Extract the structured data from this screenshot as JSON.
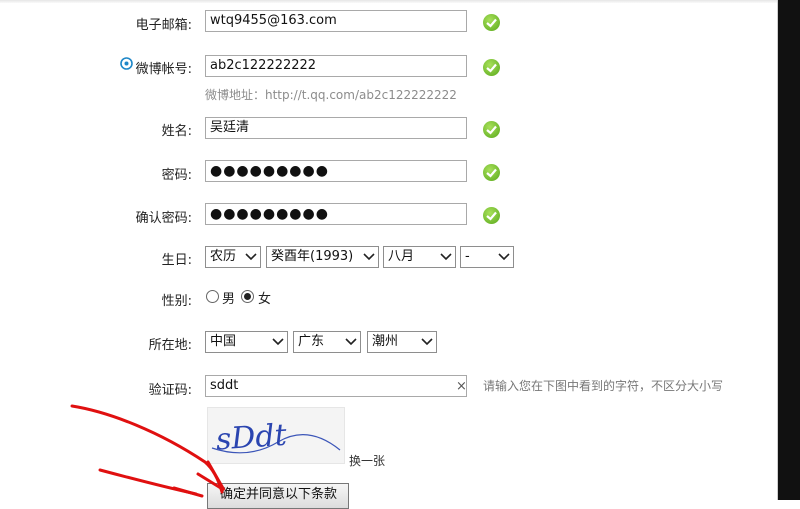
{
  "form": {
    "email": {
      "label": "电子邮箱:",
      "value": "wtq9455@163.com"
    },
    "weibo": {
      "label": "微博帐号:",
      "value": "ab2c122222222",
      "hint": "微博地址：http://t.qq.com/ab2c122222222"
    },
    "name": {
      "label": "姓名:",
      "value": "吴廷清"
    },
    "password": {
      "label": "密码:",
      "value": "●●●●●●●●●"
    },
    "confirm": {
      "label": "确认密码:",
      "value": "●●●●●●●●●"
    },
    "birthday": {
      "label": "生日:",
      "calendar": "农历",
      "year": "癸酉年(1993)",
      "month": "八月",
      "day": "-"
    },
    "gender": {
      "label": "性别:",
      "male": "男",
      "female": "女",
      "selected": "女"
    },
    "location": {
      "label": "所在地:",
      "country": "中国",
      "province": "广东",
      "city": "潮州"
    },
    "captcha": {
      "label": "验证码:",
      "value": "sddt",
      "clear": "×",
      "hint": "请输入您在下图中看到的字符，不区分大小写",
      "image_text": "sDdt",
      "refresh": "换一张"
    },
    "submit": "确定并同意以下条款"
  },
  "colors": {
    "ok_green": "#58a81b",
    "annotation_red": "#e01010",
    "hint_gray": "#8c8c8c"
  },
  "icons": {
    "valid": "check-circle-icon",
    "weibo": "weibo-logo-icon",
    "dropdown": "chevron-down-icon"
  }
}
